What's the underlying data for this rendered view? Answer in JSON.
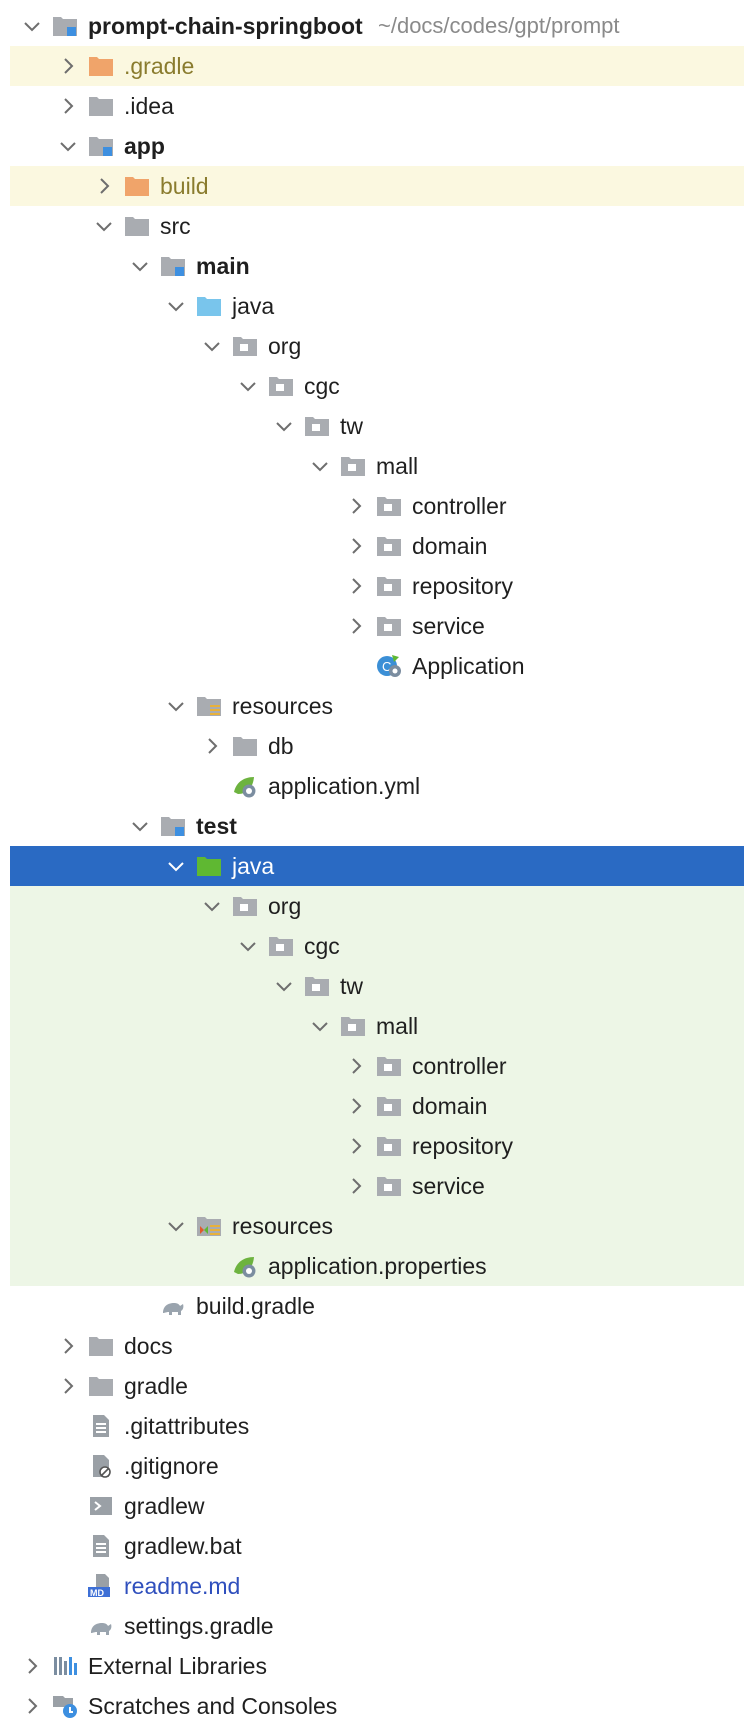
{
  "project": {
    "name": "prompt-chain-springboot",
    "path": "~/docs/codes/gpt/prompt"
  },
  "tree": [
    {
      "label": "prompt-chain-springboot",
      "depth": 0,
      "arrow": "down",
      "icon": "module-folder",
      "bold": true,
      "bg": "none"
    },
    {
      "label": ".gradle",
      "depth": 1,
      "arrow": "right",
      "icon": "folder-orange",
      "style": "excluded",
      "bg": "excluded"
    },
    {
      "label": ".idea",
      "depth": 1,
      "arrow": "right",
      "icon": "folder",
      "bg": "none"
    },
    {
      "label": "app",
      "depth": 1,
      "arrow": "down",
      "icon": "module-folder",
      "bold": true,
      "bg": "none"
    },
    {
      "label": "build",
      "depth": 2,
      "arrow": "right",
      "icon": "folder-orange",
      "style": "excluded",
      "bg": "excluded"
    },
    {
      "label": "src",
      "depth": 2,
      "arrow": "down",
      "icon": "folder",
      "bg": "none"
    },
    {
      "label": "main",
      "depth": 3,
      "arrow": "down",
      "icon": "module-folder",
      "bold": true,
      "bg": "none"
    },
    {
      "label": "java",
      "depth": 4,
      "arrow": "down",
      "icon": "folder-blue",
      "bg": "none"
    },
    {
      "label": "org",
      "depth": 5,
      "arrow": "down",
      "icon": "package",
      "bg": "none"
    },
    {
      "label": "cgc",
      "depth": 6,
      "arrow": "down",
      "icon": "package",
      "bg": "none"
    },
    {
      "label": "tw",
      "depth": 7,
      "arrow": "down",
      "icon": "package",
      "bg": "none"
    },
    {
      "label": "mall",
      "depth": 8,
      "arrow": "down",
      "icon": "package",
      "bg": "none"
    },
    {
      "label": "controller",
      "depth": 9,
      "arrow": "right",
      "icon": "package",
      "bg": "none"
    },
    {
      "label": "domain",
      "depth": 9,
      "arrow": "right",
      "icon": "package",
      "bg": "none"
    },
    {
      "label": "repository",
      "depth": 9,
      "arrow": "right",
      "icon": "package",
      "bg": "none"
    },
    {
      "label": "service",
      "depth": 9,
      "arrow": "right",
      "icon": "package",
      "bg": "none"
    },
    {
      "label": "Application",
      "depth": 9,
      "arrow": "none",
      "icon": "spring-class",
      "bg": "none"
    },
    {
      "label": "resources",
      "depth": 4,
      "arrow": "down",
      "icon": "resources-folder",
      "bg": "none"
    },
    {
      "label": "db",
      "depth": 5,
      "arrow": "right",
      "icon": "folder",
      "bg": "none"
    },
    {
      "label": "application.yml",
      "depth": 5,
      "arrow": "none",
      "icon": "spring-config",
      "bg": "none"
    },
    {
      "label": "test",
      "depth": 3,
      "arrow": "down",
      "icon": "module-folder",
      "bold": true,
      "bg": "none"
    },
    {
      "label": "java",
      "depth": 4,
      "arrow": "down",
      "icon": "folder-green",
      "bg": "selected"
    },
    {
      "label": "org",
      "depth": 5,
      "arrow": "down",
      "icon": "package",
      "bg": "testarea"
    },
    {
      "label": "cgc",
      "depth": 6,
      "arrow": "down",
      "icon": "package",
      "bg": "testarea"
    },
    {
      "label": "tw",
      "depth": 7,
      "arrow": "down",
      "icon": "package",
      "bg": "testarea"
    },
    {
      "label": "mall",
      "depth": 8,
      "arrow": "down",
      "icon": "package",
      "bg": "testarea"
    },
    {
      "label": "controller",
      "depth": 9,
      "arrow": "right",
      "icon": "package",
      "bg": "testarea"
    },
    {
      "label": "domain",
      "depth": 9,
      "arrow": "right",
      "icon": "package",
      "bg": "testarea"
    },
    {
      "label": "repository",
      "depth": 9,
      "arrow": "right",
      "icon": "package",
      "bg": "testarea"
    },
    {
      "label": "service",
      "depth": 9,
      "arrow": "right",
      "icon": "package",
      "bg": "testarea"
    },
    {
      "label": "resources",
      "depth": 4,
      "arrow": "down",
      "icon": "test-resources-folder",
      "bg": "testarea"
    },
    {
      "label": "application.properties",
      "depth": 5,
      "arrow": "none",
      "icon": "spring-config",
      "bg": "testarea"
    },
    {
      "label": "build.gradle",
      "depth": 3,
      "arrow": "none",
      "icon": "gradle-elephant",
      "bg": "none"
    },
    {
      "label": "docs",
      "depth": 1,
      "arrow": "right",
      "icon": "folder",
      "bg": "none"
    },
    {
      "label": "gradle",
      "depth": 1,
      "arrow": "right",
      "icon": "folder",
      "bg": "none"
    },
    {
      "label": ".gitattributes",
      "depth": 1,
      "arrow": "none",
      "icon": "text-file",
      "bg": "none"
    },
    {
      "label": ".gitignore",
      "depth": 1,
      "arrow": "none",
      "icon": "ignore-file",
      "bg": "none"
    },
    {
      "label": "gradlew",
      "depth": 1,
      "arrow": "none",
      "icon": "shell-script",
      "bg": "none"
    },
    {
      "label": "gradlew.bat",
      "depth": 1,
      "arrow": "none",
      "icon": "text-file",
      "bg": "none"
    },
    {
      "label": "readme.md",
      "depth": 1,
      "arrow": "none",
      "icon": "markdown-file",
      "style": "md",
      "bg": "none"
    },
    {
      "label": "settings.gradle",
      "depth": 1,
      "arrow": "none",
      "icon": "gradle-elephant",
      "bg": "none"
    },
    {
      "label": "External Libraries",
      "depth": 0,
      "arrow": "right",
      "icon": "libraries",
      "bg": "none"
    },
    {
      "label": "Scratches and Consoles",
      "depth": 0,
      "arrow": "right",
      "icon": "scratches",
      "bg": "none"
    }
  ],
  "colors": {
    "selected": "#2a6ac3",
    "excluded_bg": "#fbf8e0",
    "test_bg": "#edf6e6",
    "excluded_text": "#8a7c2e",
    "markdown_text": "#2f4fbd"
  }
}
